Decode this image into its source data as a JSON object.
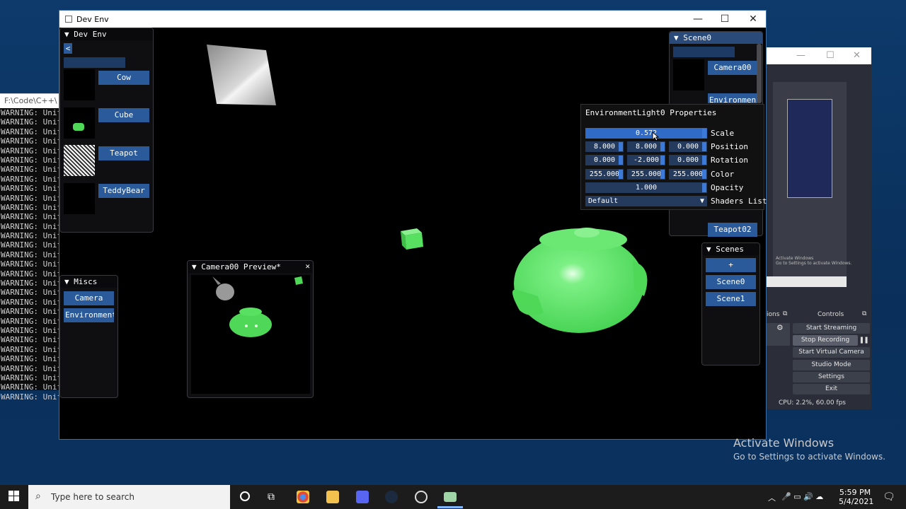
{
  "console": {
    "title": "F:\\Code\\C++\\",
    "line_text": "WARNING: Unifo",
    "line_count": 31
  },
  "window": {
    "title": "Dev Env",
    "min": "—",
    "max": "☐",
    "close": "✕"
  },
  "devenv_panel": {
    "title": "▼ Dev Env",
    "back": "<",
    "items": [
      "Cow",
      "Cube",
      "Teapot",
      "TeddyBear"
    ]
  },
  "miscs_panel": {
    "title": "▼ Miscs",
    "items": [
      "Camera",
      "EnvironmentL"
    ]
  },
  "preview_panel": {
    "title": "▼ Camera00 Preview*",
    "close": "✕"
  },
  "scene_panel": {
    "title": "▼ Scene0",
    "items": [
      "Camera00",
      "Environmen",
      "Teapot02"
    ]
  },
  "scenes_panel": {
    "title": "▼ Scenes",
    "items": [
      "+",
      "Scene0",
      "Scene1"
    ]
  },
  "properties": {
    "title": "EnvironmentLight0 Properties",
    "rows": [
      {
        "label": "Scale",
        "values": [
          "0.572"
        ]
      },
      {
        "label": "Position",
        "values": [
          "8.000",
          "8.000",
          "0.000"
        ]
      },
      {
        "label": "Rotation",
        "values": [
          "0.000",
          "-2.000",
          "0.000"
        ]
      },
      {
        "label": "Color",
        "values": [
          "255.000",
          "255.000",
          "255.000"
        ]
      },
      {
        "label": "Opacity",
        "values": [
          "1.000"
        ]
      }
    ],
    "shader_value": "Default",
    "shader_label": "Shaders List"
  },
  "obs": {
    "controls_label": "Controls",
    "ions_label": "ions",
    "buttons": [
      "Start Streaming",
      "Stop Recording",
      "Start Virtual Camera",
      "Studio Mode",
      "Settings",
      "Exit"
    ],
    "cpu": "CPU: 2.2%, 60.00 fps",
    "preview_activate": "Activate Windows",
    "preview_activate_sub": "Go to Settings to activate Windows."
  },
  "activate": {
    "title": "Activate Windows",
    "subtitle": "Go to Settings to activate Windows."
  },
  "taskbar": {
    "search_placeholder": "Type here to search",
    "time": "5:59 PM",
    "date": "5/4/2021"
  },
  "colors": {
    "accent": "#2a5a9a",
    "teapot": "#5fe86a",
    "console_bg": "#0c0c0c"
  }
}
